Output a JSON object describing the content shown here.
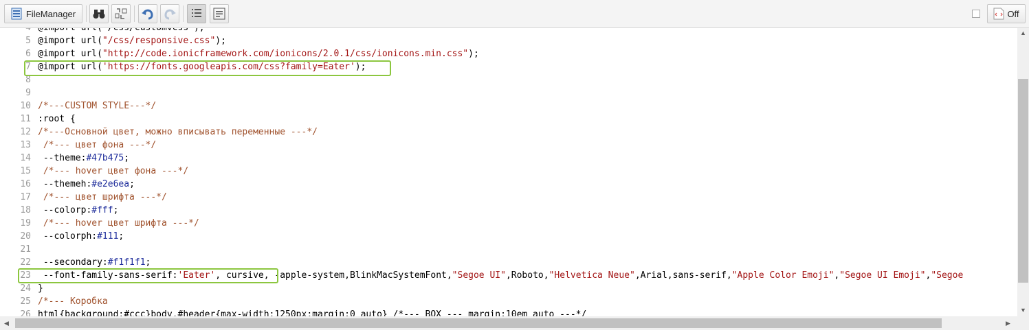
{
  "toolbar": {
    "file_manager_label": "FileManager",
    "toggle_label": "Off"
  },
  "editor": {
    "lines": [
      {
        "n": "4",
        "parts": [
          {
            "t": "@import url(\"/css/customvcss\");",
            "c": ""
          }
        ]
      },
      {
        "n": "5",
        "parts": [
          {
            "t": "@import url(",
            "c": ""
          },
          {
            "t": "\"/css/responsive.css\"",
            "c": "str"
          },
          {
            "t": ");",
            "c": ""
          }
        ]
      },
      {
        "n": "6",
        "parts": [
          {
            "t": "@import url(",
            "c": ""
          },
          {
            "t": "\"http://code.ionicframework.com/ionicons/2.0.1/css/ionicons.min.css\"",
            "c": "str"
          },
          {
            "t": ");",
            "c": ""
          }
        ]
      },
      {
        "n": "7",
        "parts": [
          {
            "t": "@import url(",
            "c": ""
          },
          {
            "t": "'https://fonts.googleapis.com/css?family=Eater'",
            "c": "str"
          },
          {
            "t": ");",
            "c": ""
          }
        ]
      },
      {
        "n": "8",
        "parts": []
      },
      {
        "n": "9",
        "parts": []
      },
      {
        "n": "10",
        "parts": [
          {
            "t": "/*---CUSTOM STYLE---*/",
            "c": "com"
          }
        ]
      },
      {
        "n": "11",
        "parts": [
          {
            "t": ":root {",
            "c": ""
          }
        ]
      },
      {
        "n": "12",
        "parts": [
          {
            "t": "/*---Основной цвет, можно вписывать переменные ---*/",
            "c": "com"
          }
        ]
      },
      {
        "n": "13",
        "parts": [
          {
            "t": " /*--- цвет фона ---*/",
            "c": "com"
          }
        ]
      },
      {
        "n": "14",
        "parts": [
          {
            "t": " --theme:",
            "c": ""
          },
          {
            "t": "#47b475",
            "c": "num"
          },
          {
            "t": ";",
            "c": ""
          }
        ]
      },
      {
        "n": "15",
        "parts": [
          {
            "t": " /*--- hover цвет фона ---*/",
            "c": "com"
          }
        ]
      },
      {
        "n": "16",
        "parts": [
          {
            "t": " --themeh:",
            "c": ""
          },
          {
            "t": "#e2e6ea",
            "c": "num"
          },
          {
            "t": ";",
            "c": ""
          }
        ]
      },
      {
        "n": "17",
        "parts": [
          {
            "t": " /*--- цвет шрифта ---*/",
            "c": "com"
          }
        ]
      },
      {
        "n": "18",
        "parts": [
          {
            "t": " --colorp:",
            "c": ""
          },
          {
            "t": "#fff",
            "c": "num"
          },
          {
            "t": ";",
            "c": ""
          }
        ]
      },
      {
        "n": "19",
        "parts": [
          {
            "t": " /*--- hover цвет шрифта ---*/",
            "c": "com"
          }
        ]
      },
      {
        "n": "20",
        "parts": [
          {
            "t": " --colorph:",
            "c": ""
          },
          {
            "t": "#111",
            "c": "num"
          },
          {
            "t": ";",
            "c": ""
          }
        ]
      },
      {
        "n": "21",
        "parts": []
      },
      {
        "n": "22",
        "parts": [
          {
            "t": " --secondary:",
            "c": ""
          },
          {
            "t": "#f1f1f1",
            "c": "num"
          },
          {
            "t": ";",
            "c": ""
          }
        ]
      },
      {
        "n": "23",
        "parts": [
          {
            "t": " --font-family-sans-serif:",
            "c": ""
          },
          {
            "t": "'Eater'",
            "c": "str"
          },
          {
            "t": ", cursive, -apple-system,BlinkMacSystemFont,",
            "c": ""
          },
          {
            "t": "\"Segoe UI\"",
            "c": "str"
          },
          {
            "t": ",Roboto,",
            "c": ""
          },
          {
            "t": "\"Helvetica Neue\"",
            "c": "str"
          },
          {
            "t": ",Arial,sans-serif,",
            "c": ""
          },
          {
            "t": "\"Apple Color Emoji\"",
            "c": "str"
          },
          {
            "t": ",",
            "c": ""
          },
          {
            "t": "\"Segoe UI Emoji\"",
            "c": "str"
          },
          {
            "t": ",",
            "c": ""
          },
          {
            "t": "\"Segoe",
            "c": "str"
          }
        ]
      },
      {
        "n": "24",
        "parts": [
          {
            "t": "}",
            "c": ""
          }
        ]
      },
      {
        "n": "25",
        "parts": [
          {
            "t": "/*--- Коробка",
            "c": "com"
          }
        ]
      },
      {
        "n": "26",
        "parts": [
          {
            "t": "html{background:#ccc}body,#header{max-width:1250px;margin:0 auto} /*--- BOX --- margin:10em auto ---*/",
            "c": ""
          }
        ]
      }
    ]
  },
  "colors": {
    "highlight": "#8cc63f",
    "comment": "#a0522d",
    "string": "#a31515",
    "hex_value": "#1b2a9a"
  }
}
